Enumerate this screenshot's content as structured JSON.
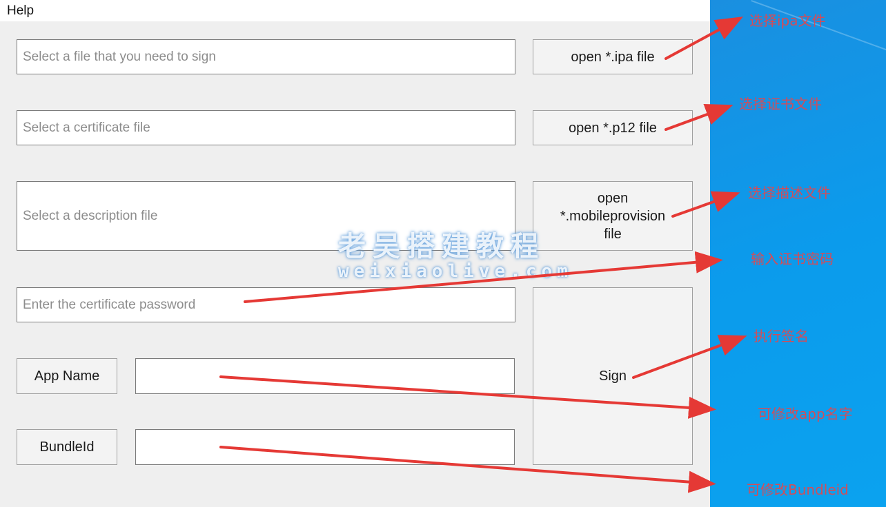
{
  "menu": {
    "items": [
      {
        "label": "Help"
      }
    ]
  },
  "form": {
    "ipa_input": {
      "value": "",
      "placeholder": "Select a file that you need to sign"
    },
    "ipa_button": {
      "label": "open *.ipa file"
    },
    "cert_input": {
      "value": "",
      "placeholder": "Select a certificate file"
    },
    "cert_button": {
      "label": "open *.p12 file"
    },
    "provision_input": {
      "value": "",
      "placeholder": "Select a description file"
    },
    "provision_button": {
      "line1": "open",
      "line2": "*.mobileprovision",
      "line3": "file"
    },
    "password_input": {
      "value": "",
      "placeholder": "Enter the certificate password"
    },
    "app_name_button": {
      "label": "App Name"
    },
    "app_name_input": {
      "value": ""
    },
    "bundle_id_button": {
      "label": "BundleId"
    },
    "bundle_id_input": {
      "value": ""
    },
    "sign_button": {
      "label": "Sign"
    }
  },
  "watermark": {
    "chinese": "老吴搭建教程",
    "domain": "weixiaolive.com"
  },
  "annotations": [
    {
      "text": "选择ipa文件"
    },
    {
      "text": "选择证书文件"
    },
    {
      "text": "选择描述文件"
    },
    {
      "text": "输入证书密码"
    },
    {
      "text": "执行签名"
    },
    {
      "text": "可修改app名字"
    },
    {
      "text": "可修改Bundleid"
    }
  ],
  "colors": {
    "annotation": "#e8454a",
    "desktop": "#0b9bec",
    "window_bg": "#efefef"
  }
}
